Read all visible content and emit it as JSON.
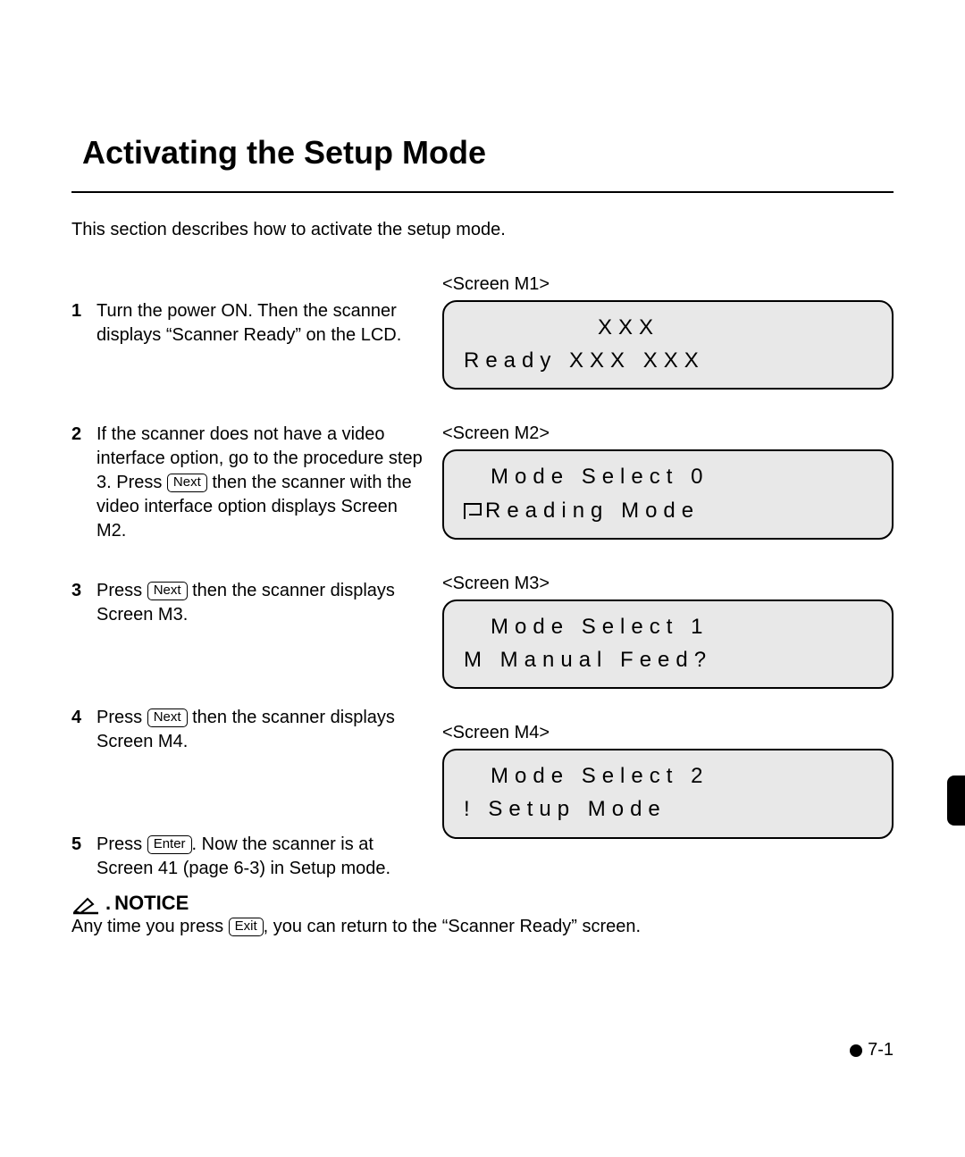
{
  "title": "Activating the Setup Mode",
  "intro": "This section describes how to activate the setup mode.",
  "keys": {
    "next": "Next",
    "enter": "Enter",
    "exit": "Exit"
  },
  "steps": {
    "s1": {
      "num": "1",
      "text": "Turn the power ON. Then the scanner displays “Scanner Ready” on the LCD."
    },
    "s2": {
      "num": "2",
      "pre": "If the scanner does not have a video interface option, go to the procedure step 3. Press ",
      "post": " then the scanner with the video interface option displays Screen M2."
    },
    "s3": {
      "num": "3",
      "pre": "Press ",
      "post": " then the scanner displays Screen M3."
    },
    "s4": {
      "num": "4",
      "pre": "Press ",
      "post": " then the scanner displays Screen M4."
    },
    "s5": {
      "num": "5",
      "pre": "Press ",
      "post": ". Now the scanner is at Screen 41 (page 6-3) in Setup mode."
    }
  },
  "screens": {
    "m1": {
      "label": "<Screen M1>",
      "line1": "XXX",
      "line2": "Ready XXX XXX"
    },
    "m2": {
      "label": "<Screen M2>",
      "line1": "Mode Select 0",
      "line2": "Reading Mode"
    },
    "m3": {
      "label": "<Screen M3>",
      "line1": "Mode Select 1",
      "line2": "M Manual Feed?"
    },
    "m4": {
      "label": "<Screen M4>",
      "line1": "Mode Select 2",
      "line2": "! Setup Mode"
    }
  },
  "notice": {
    "label": "NOTICE",
    "pre": "Any time you press ",
    "post": ", you can return to the “Scanner Ready” screen."
  },
  "page_num": "7-1"
}
